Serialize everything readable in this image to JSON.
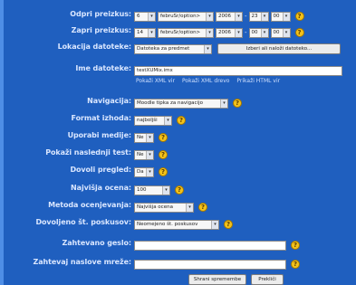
{
  "rows": {
    "open": {
      "label": "Odpri preizkus:",
      "day": "6",
      "month": "februSr/option>",
      "year": "2006",
      "hour": "23",
      "minute": "00"
    },
    "close": {
      "label": "Zapri preizkus:",
      "day": "14",
      "month": "februSr/option>",
      "year": "2006",
      "hour": "00",
      "minute": "00"
    },
    "location": {
      "label": "Lokacija datoteke:",
      "value": "Datoteka za predmet",
      "button": "Izberi ali naloži datoteko..."
    },
    "filename": {
      "label": "Ime datoteke:",
      "value": "testXUMix.imx",
      "links": [
        "Pokaži XML vir",
        "Pokaži XML drevo",
        "Prikaži HTML vir"
      ]
    },
    "navigation": {
      "label": "Navigacija:",
      "value": "Moodle tipka za navigacijo"
    },
    "format": {
      "label": "Format izhoda:",
      "value": "najboljši"
    },
    "media": {
      "label": "Uporabi medije:",
      "value": "Ne"
    },
    "nexttest": {
      "label": "Pokaži naslednji test:",
      "value": "Ne"
    },
    "review": {
      "label": "Dovoli pregled:",
      "value": "Da"
    },
    "maxgrade": {
      "label": "Najvišja ocena:",
      "value": "100"
    },
    "method": {
      "label": "Metoda ocenjevanja:",
      "value": "Najvišja ocena"
    },
    "attempts": {
      "label": "Dovoljeno št. poskusov:",
      "value": "Neomejeno št. poskusov"
    },
    "password": {
      "label": "Zahtevano geslo:",
      "value": ""
    },
    "network": {
      "label": "Zahtevaj naslove mreže:",
      "value": ""
    }
  },
  "buttons": {
    "save": "Shrani spremembe",
    "cancel": "Prekliči"
  },
  "help_glyph": "?",
  "dropdown_glyph": "▾",
  "colors": {
    "background": "#1f5fbf",
    "label": "#d9e6ff",
    "help": "#f3c21a"
  }
}
